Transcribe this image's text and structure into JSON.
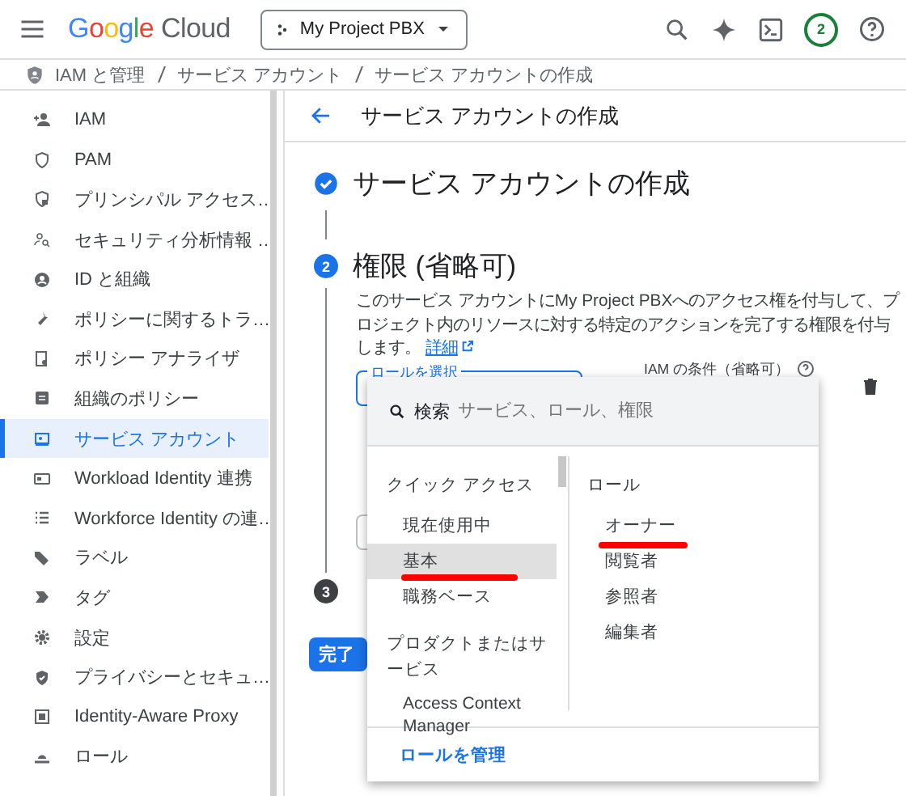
{
  "header": {
    "logo": "Google Cloud",
    "project": "My Project PBX",
    "notification_count": "2"
  },
  "breadcrumb": [
    "IAM と管理",
    "サービス アカウント",
    "サービス アカウントの作成"
  ],
  "sidebar": {
    "items": [
      {
        "label": "IAM",
        "selected": false
      },
      {
        "label": "PAM",
        "selected": false
      },
      {
        "label": "プリンシパル アクセス…",
        "selected": false
      },
      {
        "label": "セキュリティ分析情報 …",
        "selected": false
      },
      {
        "label": "ID と組織",
        "selected": false
      },
      {
        "label": "ポリシーに関するトラ…",
        "selected": false
      },
      {
        "label": "ポリシー アナライザ",
        "selected": false
      },
      {
        "label": "組織のポリシー",
        "selected": false
      },
      {
        "label": "サービス アカウント",
        "selected": true
      },
      {
        "label": "Workload Identity 連携",
        "selected": false
      },
      {
        "label": "Workforce Identity の連…",
        "selected": false
      },
      {
        "label": "ラベル",
        "selected": false
      },
      {
        "label": "タグ",
        "selected": false
      },
      {
        "label": "設定",
        "selected": false
      },
      {
        "label": "プライバシーとセキュ…",
        "selected": false
      },
      {
        "label": "Identity-Aware Proxy",
        "selected": false
      },
      {
        "label": "ロール",
        "selected": false
      }
    ]
  },
  "page": {
    "title": "サービス アカウントの作成"
  },
  "steps": [
    {
      "kind": "done",
      "title": "サービス アカウントの作成"
    },
    {
      "kind": "active",
      "number": "2",
      "title": "権限 (省略可)",
      "description": "このサービス アカウントにMy Project PBXへのアクセス権を付与して、プロジェクト内のリソースに対する特定のアクションを完了する権限を付与します。",
      "link": "詳細"
    },
    {
      "kind": "pending",
      "number": "3"
    }
  ],
  "role_field": {
    "label": "ロールを選択"
  },
  "condition_label": "IAM の条件（省略可）",
  "done_button": "完了",
  "dropdown": {
    "search_label": "検索",
    "placeholder": "サービス、ロール、権限",
    "sections": [
      {
        "heading": "クイック アクセス",
        "items": [
          {
            "label": "現在使用中",
            "selected": false,
            "underlined": false
          },
          {
            "label": "基本",
            "selected": true,
            "underlined": true
          },
          {
            "label": "職務ベース",
            "selected": false,
            "underlined": false
          }
        ]
      },
      {
        "heading": "プロダクトまたはサービス",
        "items": [
          {
            "label": "Access Context Manager",
            "selected": false,
            "underlined": false
          }
        ]
      }
    ],
    "roles": {
      "heading": "ロール",
      "items": [
        {
          "label": "オーナー",
          "underlined": true
        },
        {
          "label": "閲覧者",
          "underlined": false
        },
        {
          "label": "参照者",
          "underlined": false
        },
        {
          "label": "編集者",
          "underlined": false
        }
      ]
    },
    "footer_link": "ロールを管理"
  }
}
